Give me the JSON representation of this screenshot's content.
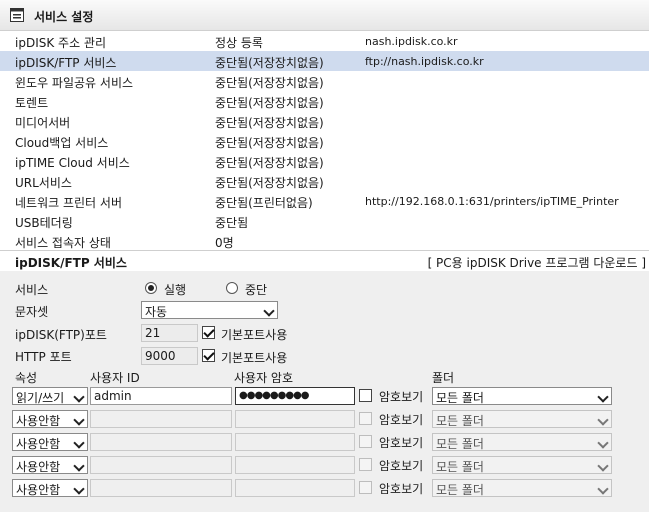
{
  "header": {
    "title": "서비스 설정",
    "icon": "settings-window-icon"
  },
  "services": [
    {
      "name": "ipDISK 주소 관리",
      "status": "정상 등록",
      "address": "nash.ipdisk.co.kr"
    },
    {
      "name": "ipDISK/FTP 서비스",
      "status": "중단됨(저장장치없음)",
      "address": "ftp://nash.ipdisk.co.kr"
    },
    {
      "name": "윈도우 파일공유 서비스",
      "status": "중단됨(저장장치없음)",
      "address": ""
    },
    {
      "name": "토렌트",
      "status": "중단됨(저장장치없음)",
      "address": ""
    },
    {
      "name": "미디어서버",
      "status": "중단됨(저장장치없음)",
      "address": ""
    },
    {
      "name": "Cloud백업 서비스",
      "status": "중단됨(저장장치없음)",
      "address": ""
    },
    {
      "name": "ipTIME Cloud 서비스",
      "status": "중단됨(저장장치없음)",
      "address": ""
    },
    {
      "name": "URL서비스",
      "status": "중단됨(저장장치없음)",
      "address": ""
    },
    {
      "name": "네트워크 프린터 서버",
      "status": "중단됨(프린터없음)",
      "address": "http://192.168.0.1:631/printers/ipTIME_Printer"
    },
    {
      "name": "USB테더링",
      "status": "중단됨",
      "address": ""
    },
    {
      "name": "서비스 접속자 상태",
      "status": "0명",
      "address": ""
    }
  ],
  "ftp_section": {
    "title": "ipDISK/FTP 서비스",
    "download_link": "[ PC용 ipDISK Drive 프로그램 다운로드 ]",
    "service_label": "서비스",
    "run_label": "실행",
    "stop_label": "중단",
    "charset_label": "문자셋",
    "charset_value": "자동",
    "ftp_port_label": "ipDISK(FTP)포트",
    "ftp_port_value": "21",
    "default_port_label": "기본포트사용",
    "http_port_label": "HTTP 포트",
    "http_port_value": "9000",
    "columns": {
      "attr": "속성",
      "user_id": "사용자 ID",
      "password": "사용자 암호",
      "folder": "폴더"
    },
    "show_password_label": "암호보기",
    "users": [
      {
        "attr": "읽기/쓰기",
        "user_id": "admin",
        "password": "●●●●●●●●●",
        "folder": "모든 폴더"
      },
      {
        "attr": "사용안함",
        "user_id": "",
        "password": "",
        "folder": "모든 폴더"
      },
      {
        "attr": "사용안함",
        "user_id": "",
        "password": "",
        "folder": "모든 폴더"
      },
      {
        "attr": "사용안함",
        "user_id": "",
        "password": "",
        "folder": "모든 폴더"
      },
      {
        "attr": "사용안함",
        "user_id": "",
        "password": "",
        "folder": "모든 폴더"
      }
    ]
  },
  "colors": {
    "selected_row": "#cfdbee",
    "panel_bg": "#efefef"
  }
}
